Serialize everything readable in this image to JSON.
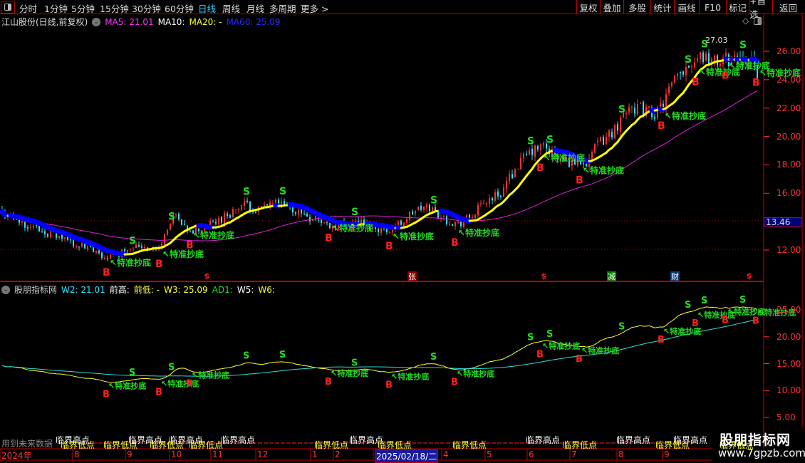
{
  "toolbar": {
    "periods": [
      "分时",
      "1分钟",
      "5分钟",
      "15分钟",
      "30分钟",
      "60分钟",
      "日线",
      "周线",
      "月线",
      "多周期",
      "更多 >"
    ],
    "active_period": "日线",
    "buttons": [
      "复权",
      "叠加",
      "多股",
      "统计",
      "画线",
      "F10",
      "标记",
      "+自选",
      "返回"
    ]
  },
  "main_legend": {
    "title": "江山股份(日线,前复权)",
    "ma5": "MA5: 21.01",
    "ma10": "MA10:",
    "ma20": "MA20: -",
    "ma60": "MA60: 25.09"
  },
  "indicator_legend": {
    "title": "股朋指标网",
    "w2": "W2: 21.01",
    "qiangao": "前高:",
    "qiandi": "前低: -",
    "w3": "W3: 25.09",
    "ad1": "AD1:",
    "w5": "W5:",
    "w6": "W6:"
  },
  "colors": {
    "up": "#ff3333",
    "down": "#33e0ff",
    "ma_rise": "#ffff00",
    "ma_fall": "#0000ff",
    "ma60": "#e020e0",
    "indicator_fast": "#ffff33",
    "indicator_slow": "#33dddd",
    "signal_buy": "#ff2020",
    "signal_sell": "#22dd22",
    "border": "#c00000"
  },
  "price_axis": {
    "ticks": [
      "26.00",
      "24.00",
      "22.00",
      "20.00",
      "18.00",
      "16.00",
      "12.00"
    ],
    "cursor_value": "13.46",
    "max_label": "27.03"
  },
  "indicator_axis": {
    "ticks": [
      "25.00",
      "20.00",
      "15.00",
      "10.00",
      "5.00"
    ]
  },
  "chart_data": {
    "type": "candlestick",
    "weekly_closes": [
      14.6,
      14.1,
      13.7,
      13.3,
      12.9,
      12.5,
      12.1,
      11.5,
      11.6,
      12.3,
      12.3,
      12.0,
      14.5,
      13.2,
      13.5,
      14.0,
      14.6,
      15.2,
      14.8,
      15.3,
      15.0,
      14.6,
      14.2,
      13.7,
      13.8,
      14.0,
      13.6,
      13.4,
      13.9,
      14.8,
      15.0,
      14.2,
      13.8,
      14.4,
      15.5,
      16.0,
      17.8,
      18.8,
      19.3,
      18.4,
      18.2,
      18.3,
      19.6,
      20.5,
      22.3,
      21.8,
      21.6,
      23.5,
      25.0,
      25.8,
      25.2,
      25.4,
      25.8,
      24.6
    ],
    "ylim": [
      11,
      27.5
    ]
  },
  "signals": {
    "buy": "B",
    "sell": "S",
    "label": "特准抄底"
  },
  "events": [
    {
      "text": "$",
      "color": "#ff2020"
    },
    {
      "text": "张",
      "color": "#8b0000"
    },
    {
      "text": "$",
      "color": "#ff2020"
    },
    {
      "text": "减",
      "color": "#008000"
    },
    {
      "text": "财",
      "color": "#0a3a7a"
    },
    {
      "text": "$",
      "color": "#ff2020"
    }
  ],
  "bottom": {
    "future_data": "用到未来数据",
    "high_label": "临界高点",
    "low_label": "临界低点",
    "dates": [
      "2024年",
      "8",
      "9",
      "10",
      "11",
      "12",
      "1",
      "2",
      "2025/02/18/二",
      "4",
      "5",
      "6",
      "7",
      "8",
      "9"
    ]
  },
  "watermark": {
    "name": "股朋指标网",
    "url": "www.7gpzb.com"
  }
}
